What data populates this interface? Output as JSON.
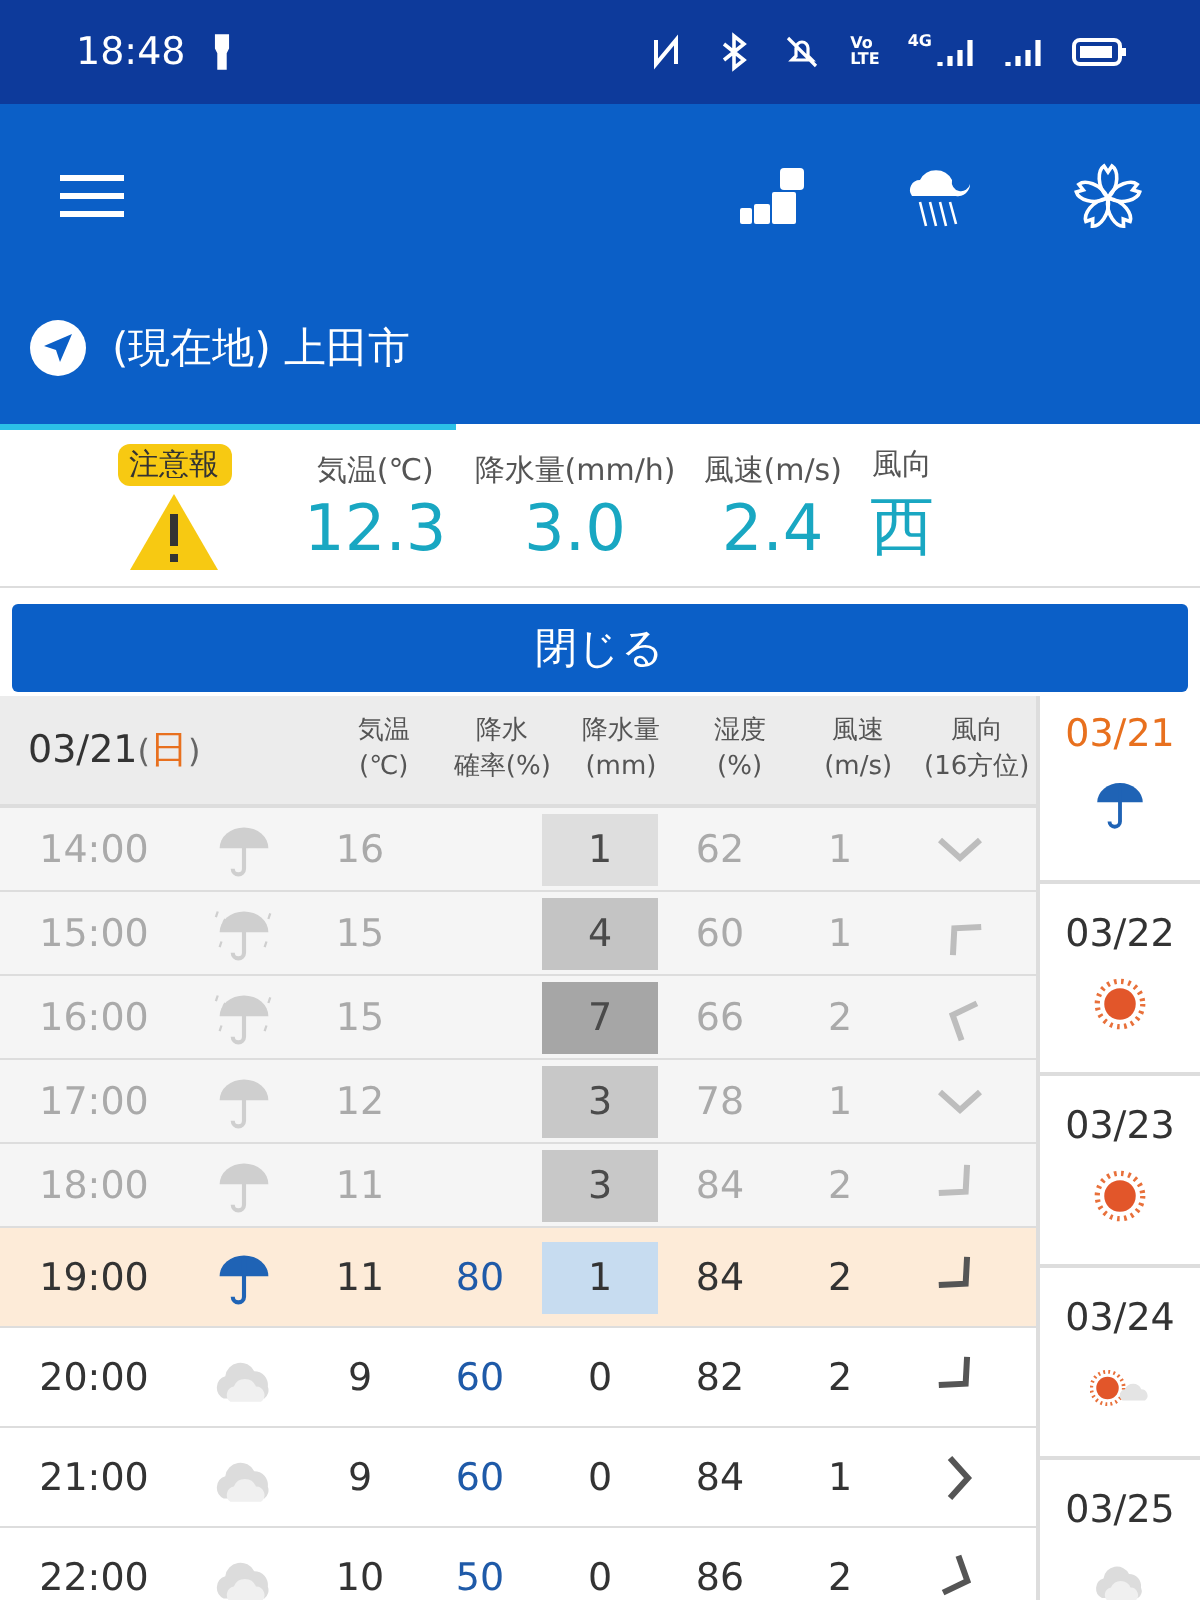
{
  "status_bar": {
    "time": "18:48",
    "volte": [
      "Vo",
      "LTE"
    ],
    "network": "4G"
  },
  "location": {
    "label": "(現在地) 上田市"
  },
  "current": {
    "warning_badge": "注意報",
    "stats": [
      {
        "label": "気温(℃)",
        "value": "12.3"
      },
      {
        "label": "降水量(mm/h)",
        "value": "3.0"
      },
      {
        "label": "風速(m/s)",
        "value": "2.4"
      },
      {
        "label": "風向",
        "value": "西"
      }
    ]
  },
  "close_button": "閉じる",
  "table": {
    "date": "03/21",
    "paren_open": "(",
    "weekday": "日",
    "paren_close": ")",
    "columns": [
      [
        "気温",
        "(℃)"
      ],
      [
        "降水",
        "確率(%)"
      ],
      [
        "降水量",
        "(mm)"
      ],
      [
        "湿度",
        "(%)"
      ],
      [
        "風速",
        "(m/s)"
      ],
      [
        "風向",
        "(16方位)"
      ]
    ],
    "rows": [
      {
        "time": "14:00",
        "kind": "past",
        "weather": {
          "kind": "umbrella"
        },
        "temp": "16",
        "rain": {
          "text": "1",
          "color": "#dedede"
        },
        "humidity": "62",
        "wind": "1",
        "arrow": {
          "kind": "s"
        }
      },
      {
        "time": "15:00",
        "kind": "past",
        "weather": {
          "kind": "rain"
        },
        "temp": "15",
        "rain": {
          "text": "4",
          "color": "#c4c4c4"
        },
        "humidity": "60",
        "wind": "1",
        "arrow": {
          "kind": "nw"
        }
      },
      {
        "time": "16:00",
        "kind": "past",
        "weather": {
          "kind": "rain"
        },
        "temp": "15",
        "rain": {
          "text": "7",
          "color": "#a6a6a6"
        },
        "humidity": "66",
        "wind": "2",
        "arrow": {
          "kind": "wnw"
        }
      },
      {
        "time": "17:00",
        "kind": "past",
        "weather": {
          "kind": "umbrella"
        },
        "temp": "12",
        "rain": {
          "text": "3",
          "color": "#c8c8c8"
        },
        "humidity": "78",
        "wind": "1",
        "arrow": {
          "kind": "s"
        }
      },
      {
        "time": "18:00",
        "kind": "past",
        "weather": {
          "kind": "umbrella"
        },
        "temp": "11",
        "rain": {
          "text": "3",
          "color": "#c8c8c8"
        },
        "humidity": "84",
        "wind": "2",
        "arrow": {
          "kind": "se"
        }
      },
      {
        "time": "19:00",
        "kind": "current",
        "weather": {
          "kind": "umbrella"
        },
        "temp": "11",
        "prob": "80",
        "rain": {
          "text": "1",
          "color": "#c7dcf0"
        },
        "humidity": "84",
        "wind": "2",
        "arrow": {
          "kind": "se"
        }
      },
      {
        "time": "20:00",
        "kind": "future",
        "weather": {
          "kind": "cloud"
        },
        "temp": "9",
        "prob": "60",
        "rain": {
          "text": "0"
        },
        "humidity": "82",
        "wind": "2",
        "arrow": {
          "kind": "se"
        }
      },
      {
        "time": "21:00",
        "kind": "future",
        "weather": {
          "kind": "cloud"
        },
        "temp": "9",
        "prob": "60",
        "rain": {
          "text": "0"
        },
        "humidity": "84",
        "wind": "1",
        "arrow": {
          "kind": "e"
        }
      },
      {
        "time": "22:00",
        "kind": "future",
        "weather": {
          "kind": "cloud"
        },
        "temp": "10",
        "prob": "50",
        "rain": {
          "text": "0"
        },
        "humidity": "86",
        "wind": "2",
        "arrow": {
          "kind": "ese"
        }
      }
    ]
  },
  "days": [
    {
      "date": "03/21",
      "selected": true,
      "weather": {
        "kind": "umbrella"
      }
    },
    {
      "date": "03/22",
      "selected": false,
      "weather": {
        "kind": "sun"
      }
    },
    {
      "date": "03/23",
      "selected": false,
      "weather": {
        "kind": "sun"
      }
    },
    {
      "date": "03/24",
      "selected": false,
      "weather": {
        "kind": "sun_cloud"
      }
    },
    {
      "date": "03/25",
      "selected": false,
      "weather": {
        "kind": "cloud"
      }
    }
  ]
}
